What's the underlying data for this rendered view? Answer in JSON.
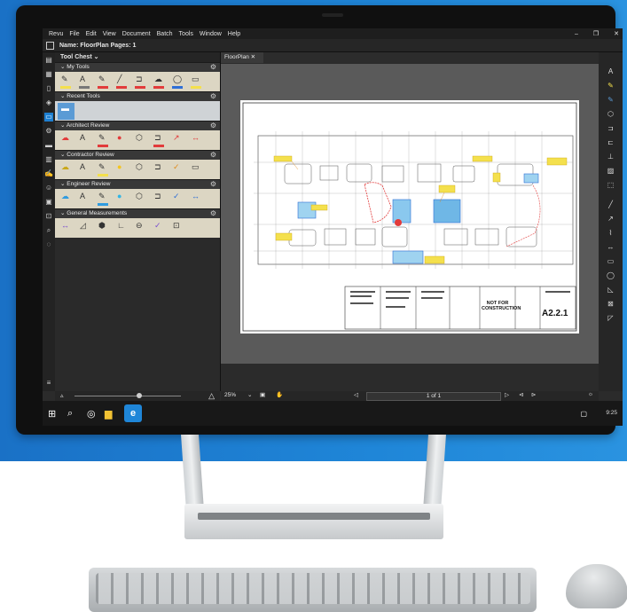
{
  "menu": [
    "Revu",
    "File",
    "Edit",
    "View",
    "Document",
    "Batch",
    "Tools",
    "Window",
    "Help"
  ],
  "doc_bar": {
    "label": "Name: FloorPlan  Pages: 1"
  },
  "tool_chest": {
    "title": "Tool Chest",
    "sections": [
      {
        "label": "My Tools"
      },
      {
        "label": "Recent Tools"
      },
      {
        "label": "Architect Review"
      },
      {
        "label": "Contractor Review"
      },
      {
        "label": "Engineer Review"
      },
      {
        "label": "General Measurements"
      }
    ]
  },
  "tab": {
    "label": "FloorPlan"
  },
  "title_block": {
    "stamp": "NOT FOR CONSTRUCTION",
    "sheet": "A2.2.1"
  },
  "status": {
    "zoom": "25%",
    "page": "1 of 1"
  },
  "clock": "9:25",
  "colors": {
    "accent": "#1d7fd1",
    "chest_row": "#dcd6c3",
    "background": "#1f86d8"
  }
}
